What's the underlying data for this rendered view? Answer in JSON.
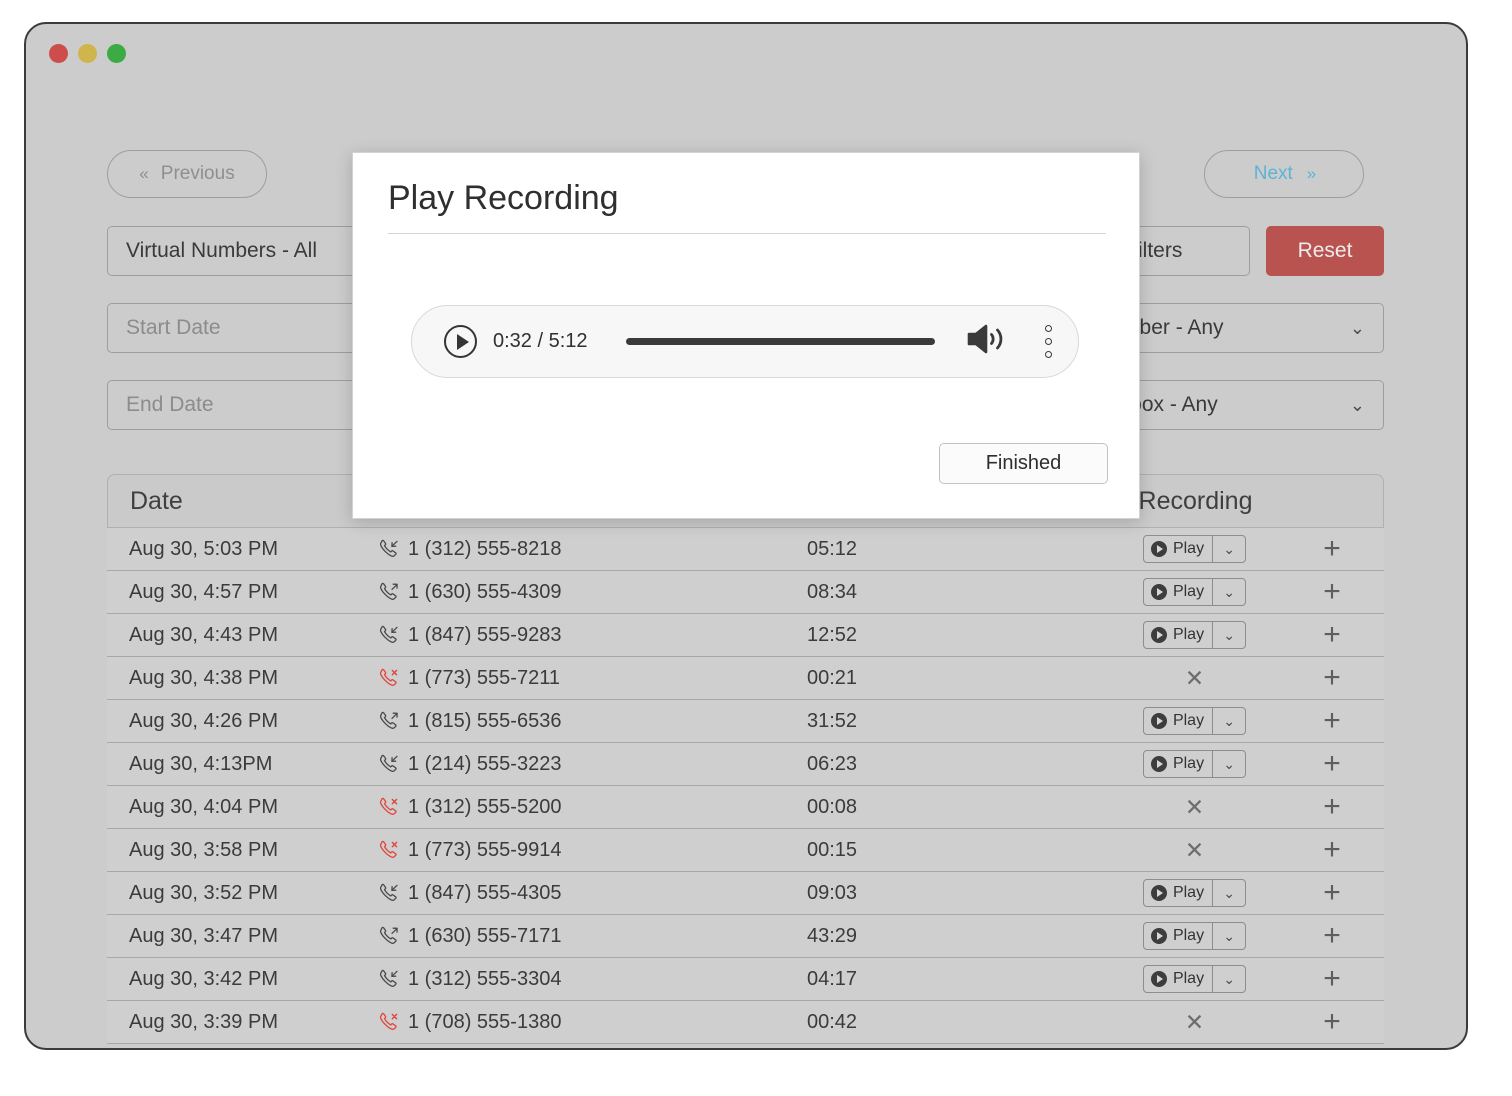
{
  "window": {
    "traffic_lights": [
      "close",
      "minimize",
      "maximize"
    ]
  },
  "toolbar": {
    "previous_label": "Previous",
    "previous_chevron": "«",
    "next_label": "Next",
    "next_chevron": "»",
    "virtual_numbers_value": "Virtual Numbers - All",
    "advanced_filters_label": "d Filters",
    "reset_label": "Reset",
    "start_date_placeholder": "Start Date",
    "end_date_placeholder": "End Date",
    "caller_number_value": "er / Number - Any",
    "voice_mailbox_value": "ice Mailbox - Any",
    "caret_glyph": "⌄"
  },
  "table": {
    "headers": {
      "date": "Date",
      "recording": "Recording"
    },
    "play_label": "Play",
    "caret_glyph": "⌄",
    "no_recording_glyph": "✕",
    "add_glyph": "+",
    "rows": [
      {
        "date": "Aug 30, 5:03 PM",
        "direction": "incoming",
        "phone": "1 (312) 555-8218",
        "duration": "05:12",
        "recording": "play"
      },
      {
        "date": "Aug 30, 4:57 PM",
        "direction": "outgoing",
        "phone": "1 (630) 555-4309",
        "duration": "08:34",
        "recording": "play"
      },
      {
        "date": "Aug 30, 4:43 PM",
        "direction": "incoming",
        "phone": "1 (847) 555-9283",
        "duration": "12:52",
        "recording": "play"
      },
      {
        "date": "Aug 30, 4:38 PM",
        "direction": "missed",
        "phone": "1 (773) 555-7211",
        "duration": "00:21",
        "recording": "none"
      },
      {
        "date": "Aug 30, 4:26 PM",
        "direction": "outgoing",
        "phone": "1 (815) 555-6536",
        "duration": "31:52",
        "recording": "play"
      },
      {
        "date": "Aug 30, 4:13PM",
        "direction": "incoming",
        "phone": "1 (214) 555-3223",
        "duration": "06:23",
        "recording": "play"
      },
      {
        "date": "Aug 30, 4:04 PM",
        "direction": "missed",
        "phone": "1 (312) 555-5200",
        "duration": "00:08",
        "recording": "none"
      },
      {
        "date": "Aug 30, 3:58 PM",
        "direction": "missed",
        "phone": "1 (773) 555-9914",
        "duration": "00:15",
        "recording": "none"
      },
      {
        "date": "Aug 30, 3:52 PM",
        "direction": "incoming",
        "phone": "1 (847) 555-4305",
        "duration": "09:03",
        "recording": "play"
      },
      {
        "date": "Aug 30, 3:47 PM",
        "direction": "outgoing",
        "phone": "1 (630) 555-7171",
        "duration": "43:29",
        "recording": "play"
      },
      {
        "date": "Aug 30, 3:42 PM",
        "direction": "incoming",
        "phone": "1 (312) 555-3304",
        "duration": "04:17",
        "recording": "play"
      },
      {
        "date": "Aug 30, 3:39 PM",
        "direction": "missed",
        "phone": "1 (708) 555-1380",
        "duration": "00:42",
        "recording": "none"
      }
    ]
  },
  "modal": {
    "title": "Play Recording",
    "player": {
      "current_time": "0:32",
      "total_time": "5:12",
      "time_display": "0:32 / 5:12",
      "progress_percent": 100
    },
    "finished_label": "Finished"
  },
  "colors": {
    "accent_blue": "#5bb4d6",
    "reset_red": "#b9534f",
    "missed_call_red": "#e0443c",
    "window_bg": "#cccccc",
    "row_bg": "#cfcfcf",
    "traffic_red": "#cc4d4a",
    "traffic_yellow": "#cfb54b",
    "traffic_green": "#3cab44"
  }
}
